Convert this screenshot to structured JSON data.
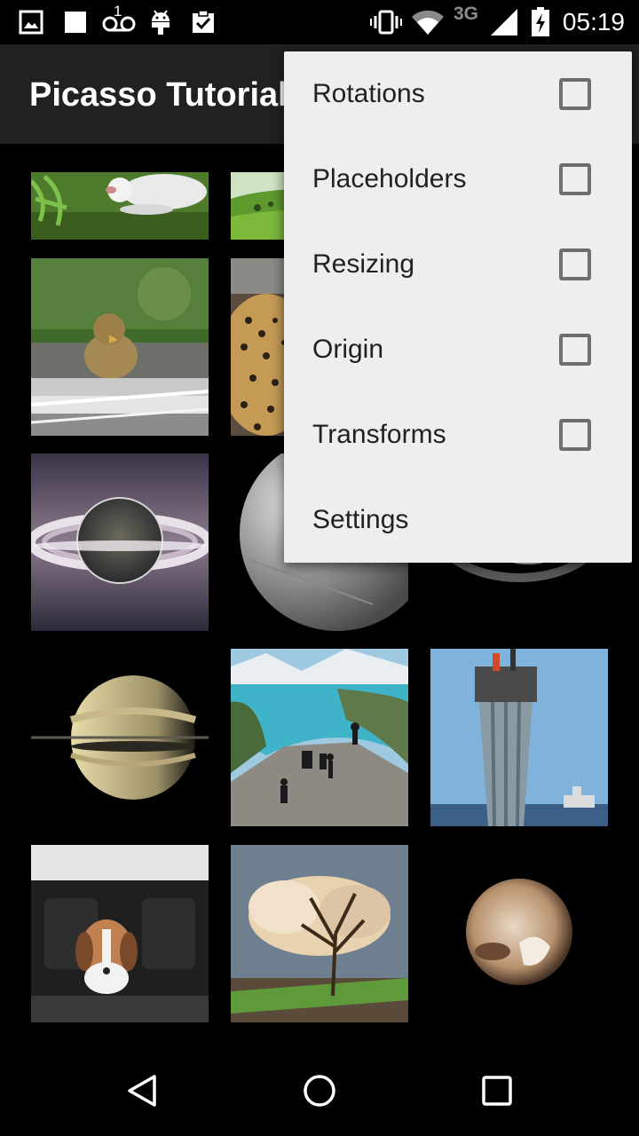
{
  "status_bar": {
    "time": "05:19",
    "network": "3G",
    "voicemail_count": "1",
    "icons": [
      "image-notification-icon",
      "square-notification-icon",
      "voicemail-icon",
      "android-debug-icon",
      "clipboard-check-icon",
      "vibrate-icon",
      "wifi-icon",
      "signal-icon",
      "battery-charging-icon"
    ]
  },
  "app_bar": {
    "title": "Picasso Tutorial"
  },
  "overflow_menu": {
    "items": [
      {
        "label": "Rotations",
        "checkbox": true,
        "checked": false
      },
      {
        "label": "Placeholders",
        "checkbox": true,
        "checked": false
      },
      {
        "label": "Resizing",
        "checkbox": true,
        "checked": false
      },
      {
        "label": "Origin",
        "checkbox": true,
        "checked": false
      },
      {
        "label": "Transforms",
        "checkbox": true,
        "checked": false
      },
      {
        "label": "Settings",
        "checkbox": false
      }
    ]
  },
  "grid": {
    "images": [
      "white-cat",
      "green-hills",
      "duckling-window",
      "cheetah-car",
      "saturn-rings",
      "moon-surface",
      "saturn-ring-dark",
      "saturn-side",
      "band-on-cliff-fjord",
      "oil-platform",
      "beagle-car-seat",
      "tree-clouds",
      "pluto"
    ]
  },
  "nav_bar": {
    "icons": [
      "back-icon",
      "home-icon",
      "recents-icon"
    ]
  },
  "colors": {
    "app_bar": "#212121",
    "menu_background": "#eeeeee",
    "checkbox_border": "#6e6e6e",
    "background": "#000000"
  }
}
